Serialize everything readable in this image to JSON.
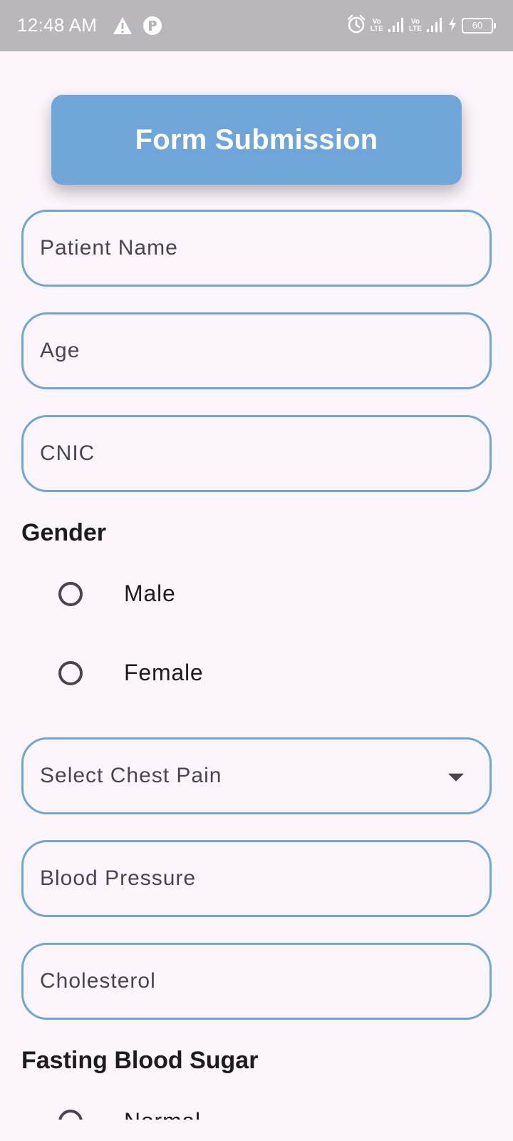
{
  "status_bar": {
    "time": "12:48 AM",
    "left_icons": [
      "warning-icon",
      "app-notification-icon"
    ],
    "right_icons": [
      "alarm-icon",
      "volte-icon",
      "signal-icon",
      "volte-icon",
      "signal-icon",
      "charging-icon"
    ],
    "volte_top": "Vo",
    "volte_bottom": "LTE",
    "battery": "60"
  },
  "header": {
    "title": "Form Submission",
    "color": "#6FA5D8"
  },
  "fields": {
    "patient_name": "Patient Name",
    "age": "Age",
    "cnic": "CNIC",
    "chest_pain": "Select Chest Pain",
    "blood_pressure": "Blood Pressure",
    "cholesterol": "Cholesterol"
  },
  "gender": {
    "heading": "Gender",
    "options": [
      "Male",
      "Female"
    ]
  },
  "fasting_blood_sugar": {
    "heading": "Fasting Blood Sugar",
    "options": [
      "Normal"
    ]
  },
  "colors": {
    "accent": "#6FA5D8",
    "background": "#FCF6FC",
    "status_bar": "#BAB7BC"
  }
}
